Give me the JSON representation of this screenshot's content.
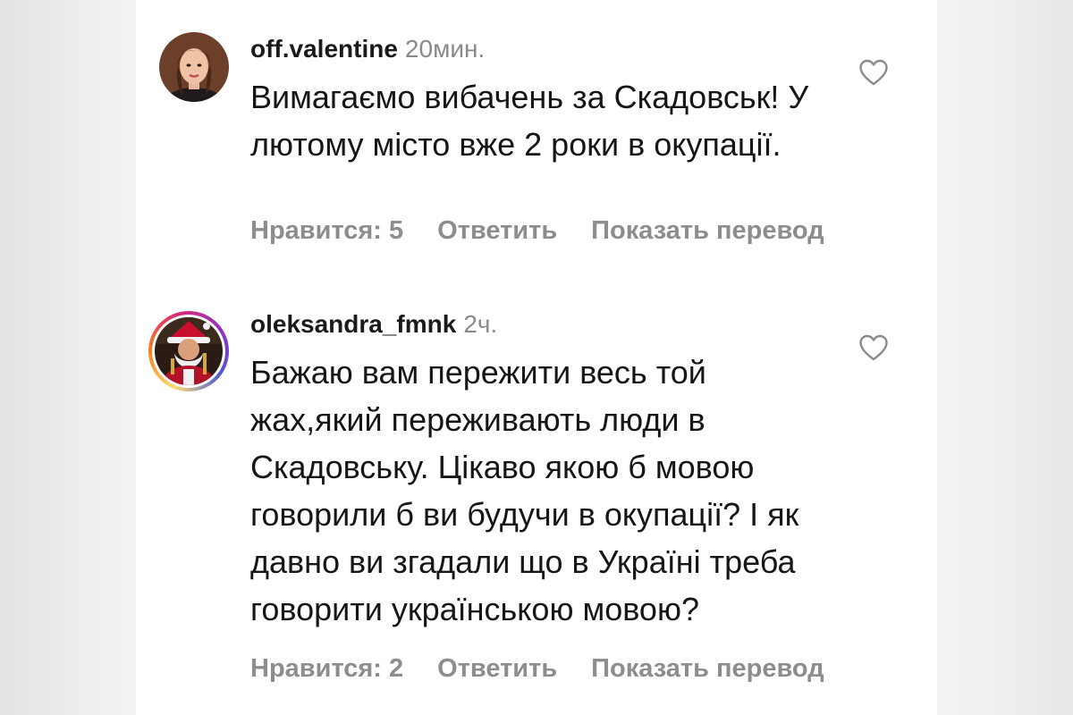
{
  "comments": [
    {
      "username": "off.valentine",
      "time": "20мин.",
      "text": "Вимагаємо вибачень за Скадовськ! У лютому місто вже 2 роки в окупації.",
      "likes": "Нравится: 5",
      "reply": "Ответить",
      "translate": "Показать перевод",
      "avatar_icon": "profile-photo",
      "like_icon": "heart-outline-icon"
    },
    {
      "username": "oleksandra_fmnk",
      "time": "2ч.",
      "text": "Бажаю вам пережити весь той жах,який переживають люди в Скадовську. Цікаво якою б мовою говорили б ви будучи в окупації? І як давно ви згадали що в Україні треба говорити українською мовою?",
      "likes": "Нравится: 2",
      "reply": "Ответить",
      "translate": "Показать перевод",
      "avatar_icon": "profile-photo-story-ring",
      "like_icon": "heart-outline-icon"
    }
  ],
  "colors": {
    "story_ring": [
      "#feda75",
      "#fa7e1e",
      "#d62976",
      "#962fbf",
      "#4f5bd5"
    ],
    "muted_text": "#8d8d8d",
    "body_text": "#161616"
  }
}
